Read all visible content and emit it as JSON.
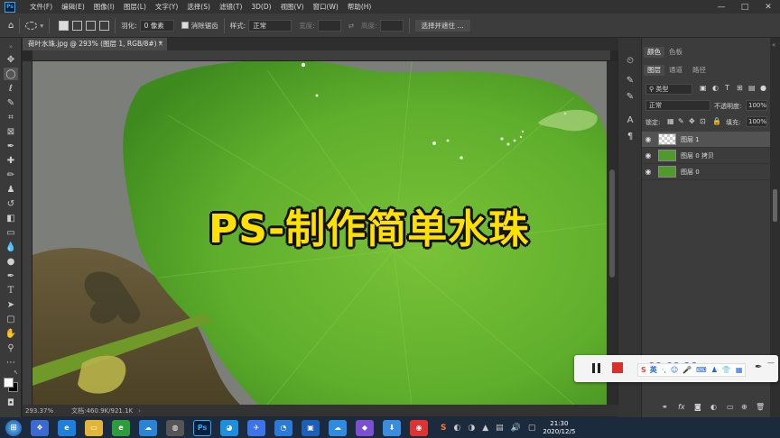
{
  "app": {
    "logo": "Ps"
  },
  "menu": [
    "文件(F)",
    "编辑(E)",
    "图像(I)",
    "图层(L)",
    "文字(Y)",
    "选择(S)",
    "滤镜(T)",
    "3D(D)",
    "视图(V)",
    "窗口(W)",
    "帮助(H)"
  ],
  "window_controls": {
    "minimize": "—",
    "maximize": "□",
    "close": "✕"
  },
  "options": {
    "feather_label": "羽化:",
    "feather_value": "0 像素",
    "antialias_label": "消除锯齿",
    "style_label": "样式:",
    "style_value": "正常",
    "width_label": "宽度:",
    "height_label": "高度:",
    "select_mask_button": "选择并遮住 ..."
  },
  "document": {
    "tab_title": "荷叶水珠.jpg @ 293% (图层 1, RGB/8#) *",
    "tab_close": "×",
    "overlay_title": "PS-制作简单水珠",
    "zoom": "293.37%",
    "doc_info": "文档:460.9K/921.1K"
  },
  "right_panel": {
    "top_tabs": [
      "颜色",
      "色板"
    ],
    "tabs": [
      "图层",
      "通道",
      "路径"
    ],
    "kind_filter": "类型",
    "blend_mode": "正常",
    "opacity_label": "不透明度:",
    "opacity_value": "100%",
    "lock_label": "锁定:",
    "fill_label": "填充:",
    "fill_value": "100%",
    "layers": [
      {
        "name": "图层 1",
        "selected": true
      },
      {
        "name": "图层 0 拷贝",
        "selected": false
      },
      {
        "name": "图层 0",
        "selected": false
      }
    ]
  },
  "recorder": {
    "time": "00:00:10"
  },
  "taskbar": {
    "clock_time": "21:30",
    "clock_date": "2020/12/5",
    "ime_label": "英"
  },
  "colors": {
    "title_yellow": "#ffe100",
    "leaf_green": "#5fae2c",
    "ps_blue": "#31a8ff",
    "record_red": "#d9302a"
  }
}
